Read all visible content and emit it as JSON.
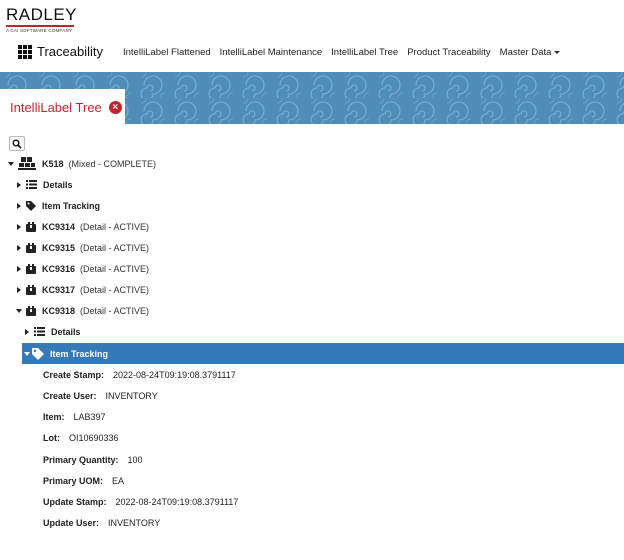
{
  "logo": {
    "word": "RADLEY",
    "sub": "A CAI SOFTWARE COMPANY"
  },
  "brand": {
    "title": "Traceability"
  },
  "nav": {
    "items": [
      "IntelliLabel Flattened",
      "IntelliLabel Maintenance",
      "IntelliLabel Tree",
      "Product Traceability"
    ],
    "dropdown": "Master Data"
  },
  "tab": {
    "label": "IntelliLabel Tree",
    "close_glyph": "×"
  },
  "tree": {
    "root": {
      "name": "K518",
      "desc": "(Mixed - COMPLETE)"
    },
    "root_children": [
      {
        "name": "Details"
      },
      {
        "name": "Item Tracking"
      },
      {
        "name": "KC9314",
        "desc": "(Detail - ACTIVE)"
      },
      {
        "name": "KC9315",
        "desc": "(Detail - ACTIVE)"
      },
      {
        "name": "KC9316",
        "desc": "(Detail - ACTIVE)"
      },
      {
        "name": "KC9317",
        "desc": "(Detail - ACTIVE)"
      },
      {
        "name": "KC9318",
        "desc": "(Detail - ACTIVE)"
      }
    ],
    "kc9318_children": [
      {
        "name": "Details"
      },
      {
        "name": "Item Tracking"
      }
    ],
    "properties": [
      {
        "label": "Create Stamp:",
        "value": "2022-08-24T09:19:08.3791117"
      },
      {
        "label": "Create User:",
        "value": "INVENTORY"
      },
      {
        "label": "Item:",
        "value": "LAB397"
      },
      {
        "label": "Lot:",
        "value": "OI10690336"
      },
      {
        "label": "Primary Quantity:",
        "value": "100"
      },
      {
        "label": "Primary UOM:",
        "value": "EA"
      },
      {
        "label": "Update Stamp:",
        "value": "2022-08-24T09:19:08.3791117"
      },
      {
        "label": "Update User:",
        "value": "INVENTORY"
      }
    ]
  },
  "colors": {
    "brand_red": "#c0272d",
    "selected_blue": "#337ab7",
    "banner_blue": "#4d8db8"
  }
}
